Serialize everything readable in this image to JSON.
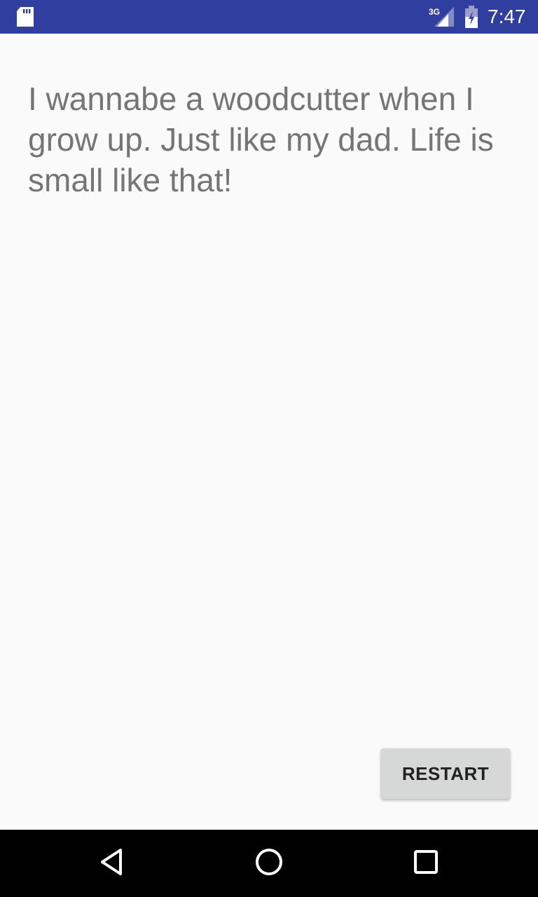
{
  "status_bar": {
    "time": "7:47",
    "network_type": "3G",
    "background_color": "#303f9f",
    "icons": [
      "sd-card-icon",
      "signal-icon",
      "battery-icon"
    ]
  },
  "main": {
    "message": "I wannabe a woodcutter when I grow up. Just like my dad. Life is small like that!",
    "text_color": "#757575"
  },
  "actions": {
    "restart_label": "RESTART",
    "button_color": "#d6d7d7"
  },
  "nav_bar": {
    "icons": [
      "back-icon",
      "home-icon",
      "recents-icon"
    ]
  }
}
